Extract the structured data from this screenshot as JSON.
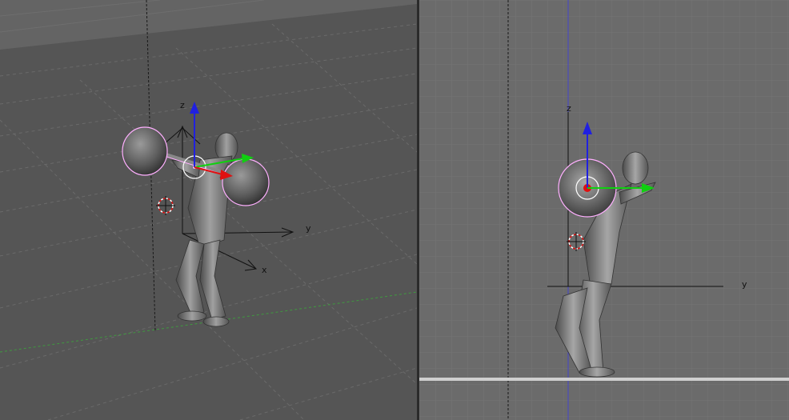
{
  "viewports": [
    {
      "name": "perspective",
      "axis_labels": {
        "z": "z",
        "y": "y",
        "x": "x"
      }
    },
    {
      "name": "side-ortho",
      "axis_labels": {
        "z": "z",
        "y": "y"
      }
    }
  ],
  "colors": {
    "grid_bg_persp": "#555555",
    "grid_bg_side": "#6b6b6b",
    "widget_x": "#e01010",
    "widget_y": "#10d010",
    "widget_z": "#2020e0",
    "selection_outline": "#ffb0ff",
    "origin_axis_blue": "#4444cc"
  },
  "icons": [
    "3d-cursor-icon",
    "transform-widget-icon",
    "world-axes-icon"
  ]
}
